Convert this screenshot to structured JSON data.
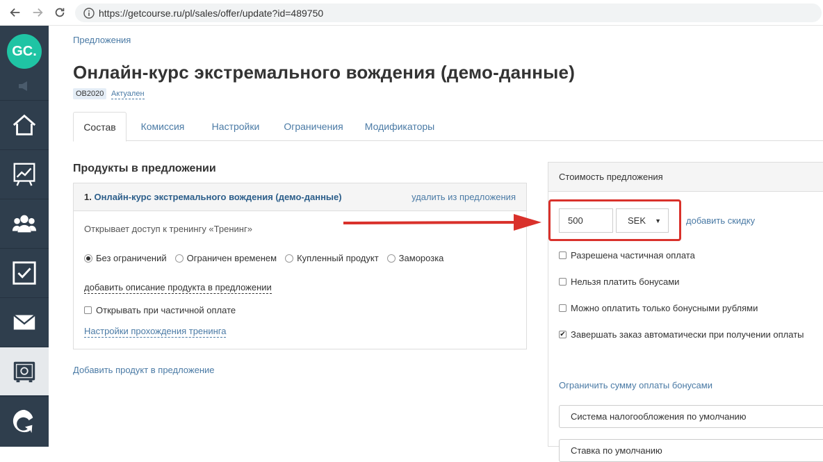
{
  "browser": {
    "url": "https://getcourse.ru/pl/sales/offer/update?id=489750"
  },
  "sidebar": {
    "logo_text": "GC.",
    "items": [
      {
        "name": "home",
        "icon": "home-icon"
      },
      {
        "name": "stats",
        "icon": "chart-icon"
      },
      {
        "name": "users",
        "icon": "users-icon"
      },
      {
        "name": "tasks",
        "icon": "checkbox-icon"
      },
      {
        "name": "mail",
        "icon": "mail-icon"
      },
      {
        "name": "sales",
        "icon": "safe-icon"
      },
      {
        "name": "brand",
        "icon": "getcourse-icon"
      }
    ]
  },
  "header": {
    "breadcrumb": "Предложения",
    "title": "Онлайн-курс экстремального вождения (демо-данные)",
    "code": "OB2020",
    "status": "Актуален"
  },
  "tabs": [
    {
      "label": "Состав",
      "active": true
    },
    {
      "label": "Комиссия",
      "active": false
    },
    {
      "label": "Настройки",
      "active": false
    },
    {
      "label": "Ограничения",
      "active": false
    },
    {
      "label": "Модификаторы",
      "active": false
    }
  ],
  "products": {
    "section_title": "Продукты в предложении",
    "item_number": "1.",
    "item_name": "Онлайн-курс экстремального вождения (демо-данные)",
    "remove_label": "удалить из предложения",
    "access_text": "Открывает доступ к тренингу «Тренинг»",
    "access_options": [
      {
        "label": "Без ограничений",
        "selected": true
      },
      {
        "label": "Ограничен временем",
        "selected": false
      },
      {
        "label": "Купленный продукт",
        "selected": false
      },
      {
        "label": "Заморозка",
        "selected": false
      }
    ],
    "add_description": "добавить описание продукта в предложении",
    "partial_open_label": "Открывать при частичной оплате",
    "training_settings": "Настройки прохождения тренинга",
    "add_product": "Добавить продукт в предложение"
  },
  "price": {
    "title": "Стоимость предложения",
    "amount": "500",
    "currency": "SEK",
    "add_discount": "добавить скидку",
    "options": [
      {
        "label": "Разрешена частичная оплата",
        "checked": false
      },
      {
        "label": "Нельзя платить бонусами",
        "checked": false
      },
      {
        "label": "Можно оплатить только бонусными рублями",
        "checked": false
      },
      {
        "label": "Завершать заказ автоматически при получении оплаты",
        "checked": true
      }
    ],
    "limit_bonus": "Ограничить сумму оплаты бонусами",
    "tax_system": "Система налогообложения по умолчанию",
    "tax_rate": "Ставка по умолчанию"
  },
  "colors": {
    "sidebar": "#2f3e4d",
    "logo": "#1fc4a4",
    "link": "#4a7aa5",
    "annotation": "#d9312b"
  }
}
